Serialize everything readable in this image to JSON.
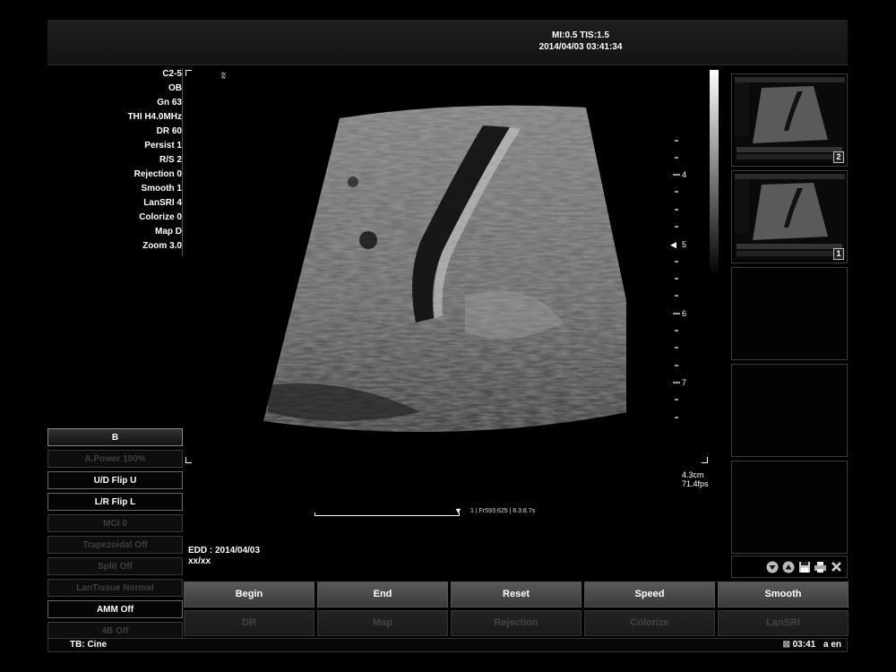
{
  "header": {
    "mi_tis": "MI:0.5 TIS:1.5",
    "datetime": "2014/04/03 03:41:34"
  },
  "params": [
    "C2-5",
    "OB",
    "Gn 63",
    "THI H4.0MHz",
    "DR 60",
    "Persist 1",
    "R/S 2",
    "Rejection 0",
    "Smooth 1",
    "LanSRI 4",
    "Colorize 0",
    "Map D",
    "Zoom 3.0"
  ],
  "probe_mark": "ʬ",
  "ruler": {
    "labels": [
      "4",
      "5",
      "6",
      "7"
    ],
    "focus_marker": "◀"
  },
  "scale_info": {
    "depth": "4.3cm",
    "frame_rate": "71.4fps"
  },
  "cine": {
    "marker": "▼",
    "info": "1 | Fr593:625 | 8.3:8.7s"
  },
  "edd": {
    "line1": "EDD : 2014/04/03",
    "line2": "xx/xx"
  },
  "left_menu": [
    {
      "label": "B",
      "state": "active"
    },
    {
      "label": "A.Power 100%",
      "state": "disabled"
    },
    {
      "label": "U/D Flip  U",
      "state": "on"
    },
    {
      "label": "L/R Flip  L",
      "state": "on"
    },
    {
      "label": "MCI 0",
      "state": "disabled"
    },
    {
      "label": "Trapezoidal  Off",
      "state": "disabled"
    },
    {
      "label": "Split  Off",
      "state": "disabled"
    },
    {
      "label": "LanTissue Normal",
      "state": "disabled"
    },
    {
      "label": "AMM  Off",
      "state": "on"
    },
    {
      "label": "4B  Off",
      "state": "disabled"
    }
  ],
  "thumbnails": [
    {
      "number": "2"
    },
    {
      "number": "1"
    },
    {
      "number": ""
    },
    {
      "number": ""
    },
    {
      "number": ""
    }
  ],
  "thumb_icons": [
    "down-arrow-icon",
    "up-arrow-icon",
    "save-icon",
    "print-icon",
    "delete-icon"
  ],
  "buttons_row1": [
    "Begin",
    "End",
    "Reset",
    "Speed",
    "Smooth"
  ],
  "buttons_row2": [
    "DR",
    "Map",
    "Rejection",
    "Colorize",
    "LanSRI"
  ],
  "status": {
    "tb": "TB: Cine",
    "clock": "03:41",
    "lang": "a  en"
  }
}
